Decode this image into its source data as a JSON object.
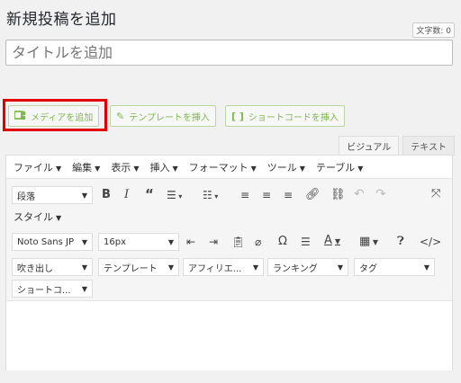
{
  "page": {
    "title": "新規投稿を追加",
    "char_count": "文字数: 0"
  },
  "title_field": {
    "placeholder": "タイトルを追加"
  },
  "media_buttons": {
    "add_media": "メディアを追加",
    "insert_template": "テンプレートを挿入",
    "insert_shortcode": "ショートコードを挿入"
  },
  "editor_tabs": {
    "visual": "ビジュアル",
    "text": "テキスト"
  },
  "menubar": [
    "ファイル",
    "編集",
    "表示",
    "挿入",
    "フォーマット",
    "ツール",
    "テーブル"
  ],
  "toolbar1": {
    "format_select": "段落",
    "style_label": "スタイル"
  },
  "toolbar2": {
    "font_family": "Noto Sans JP",
    "font_size": "16px",
    "text_color_glyph": "A"
  },
  "toolbar3": {
    "balloon": "吹き出し",
    "template": "テンプレート",
    "affiliate": "アフィリエ...",
    "ranking": "ランキング",
    "tag": "タグ",
    "shortcode": "ショートコ..."
  },
  "colors": {
    "accent_green": "#7db94c",
    "highlight_red": "#e00000"
  },
  "icons": [
    "add-media-icon",
    "pencil-icon",
    "shortcode-brackets-icon",
    "bold-icon",
    "italic-icon",
    "blockquote-icon",
    "bullet-list-icon",
    "numbered-list-icon",
    "align-left-icon",
    "align-center-icon",
    "align-right-icon",
    "link-icon",
    "unlink-icon",
    "undo-icon",
    "redo-icon",
    "fullscreen-icon",
    "indent-icon",
    "outdent-icon",
    "paste-text-icon",
    "clear-format-icon",
    "omega-icon",
    "horizontal-line-icon",
    "text-color-icon",
    "table-icon",
    "help-icon",
    "code-icon"
  ]
}
